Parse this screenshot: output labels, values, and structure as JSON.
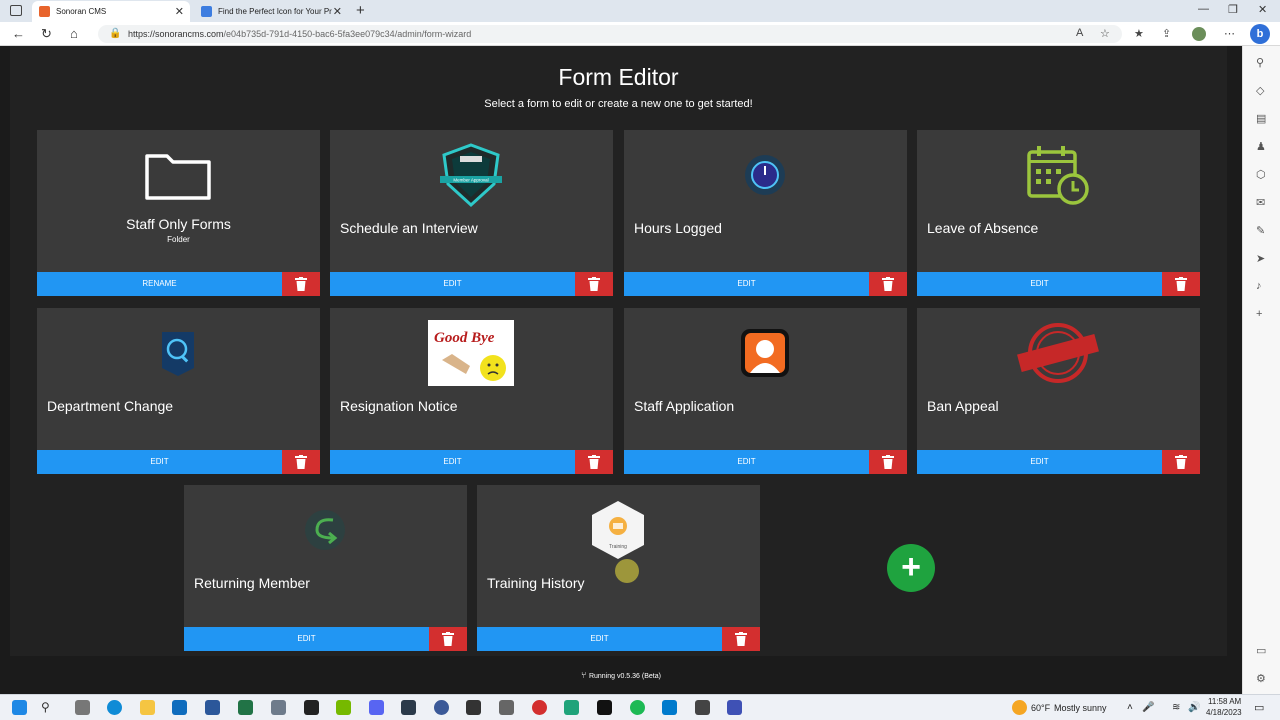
{
  "browser": {
    "tabs": [
      {
        "title": "Sonoran CMS",
        "active": true
      },
      {
        "title": "Find the Perfect Icon for Your Pr",
        "active": false
      }
    ],
    "new_tab": "+",
    "url_host": "https://sonorancms.com",
    "url_path": "/e04b735d-791d-4150-bac6-5fa3ee079c34/admin/form-wizard"
  },
  "page": {
    "title": "Form Editor",
    "subtitle": "Select a form to edit or create a new one to get started!"
  },
  "cards": [
    {
      "title": "Staff Only Forms",
      "subtitle": "Folder",
      "button": "RENAME",
      "icon": "folder-icon"
    },
    {
      "title": "Schedule an Interview",
      "button": "EDIT",
      "icon": "shield-badge-icon",
      "badge_text": "Member Approval"
    },
    {
      "title": "Hours Logged",
      "button": "EDIT",
      "icon": "clock-icon"
    },
    {
      "title": "Leave of Absence",
      "button": "EDIT",
      "icon": "calendar-clock-icon"
    },
    {
      "title": "Department Change",
      "button": "EDIT",
      "icon": "search-badge-icon"
    },
    {
      "title": "Resignation Notice",
      "button": "EDIT",
      "icon": "good-bye-image",
      "image_text": "Good Bye"
    },
    {
      "title": "Staff Application",
      "button": "EDIT",
      "icon": "person-icon"
    },
    {
      "title": "Ban Appeal",
      "button": "EDIT",
      "icon": "banned-stamp-icon"
    },
    {
      "title": "Returning Member",
      "button": "EDIT",
      "icon": "return-arrow-icon"
    },
    {
      "title": "Training History",
      "button": "EDIT",
      "icon": "training-hexagon-icon",
      "icon_label": "Training"
    }
  ],
  "add_button": "+",
  "footer": {
    "version": "Running v0.5.36 (Beta)"
  },
  "taskbar": {
    "weather_temp": "60°F",
    "weather_desc": "Mostly sunny",
    "time": "11:58 AM",
    "date": "4/18/2023"
  },
  "colors": {
    "edit_button": "#2196f3",
    "delete_button": "#d32f2f",
    "add_button": "#1fa33f",
    "card_bg": "#3a3a3a"
  }
}
